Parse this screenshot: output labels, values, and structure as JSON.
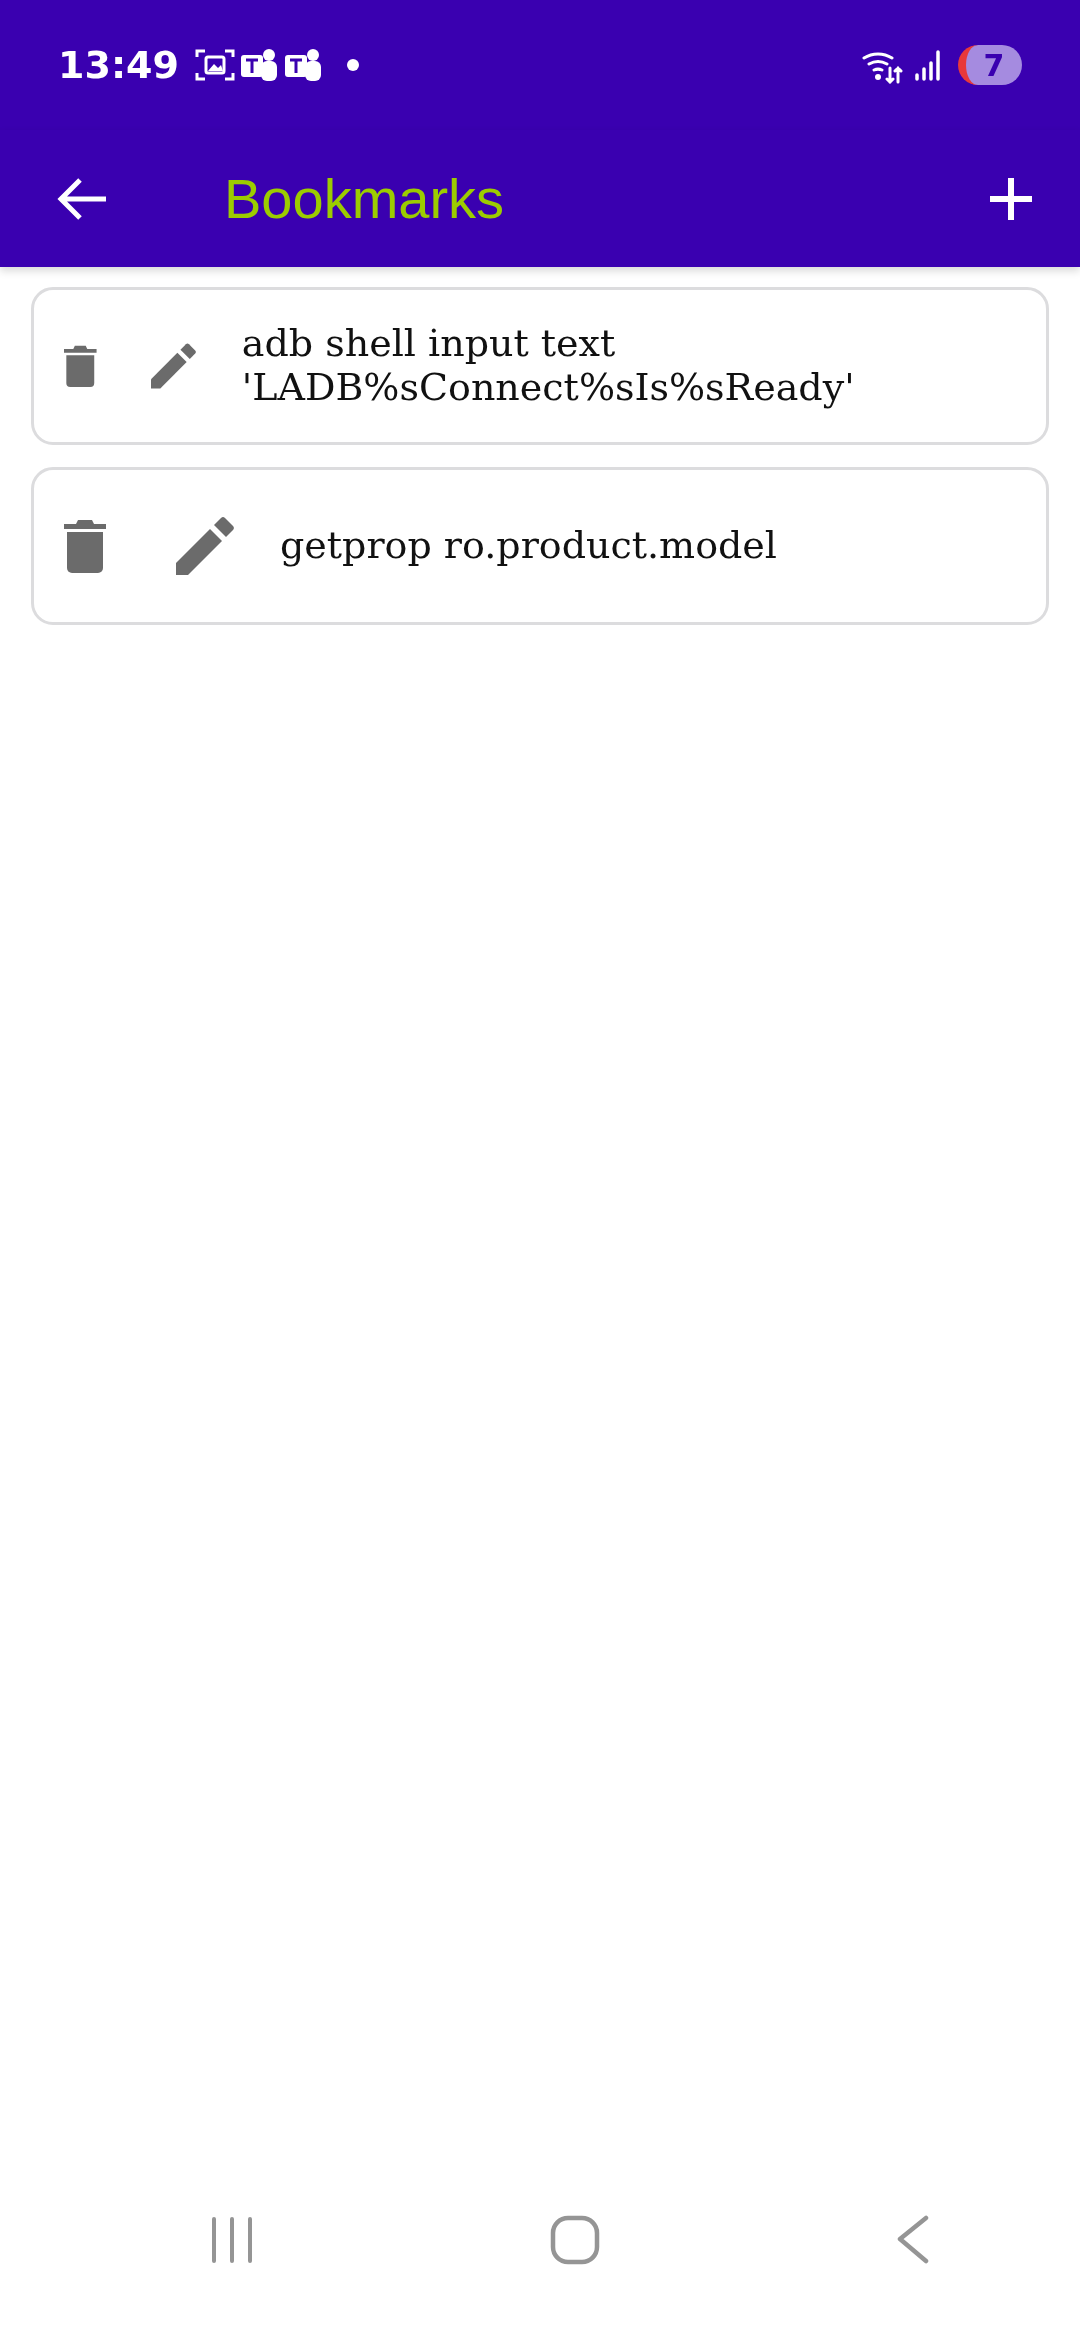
{
  "status_bar": {
    "time": "13:49",
    "battery": "7"
  },
  "app_bar": {
    "title": "Bookmarks"
  },
  "bookmarks": [
    {
      "command": "adb shell input text 'LADB%sConnect%sIs%sReady'"
    },
    {
      "command": "getprop ro.product.model"
    }
  ]
}
